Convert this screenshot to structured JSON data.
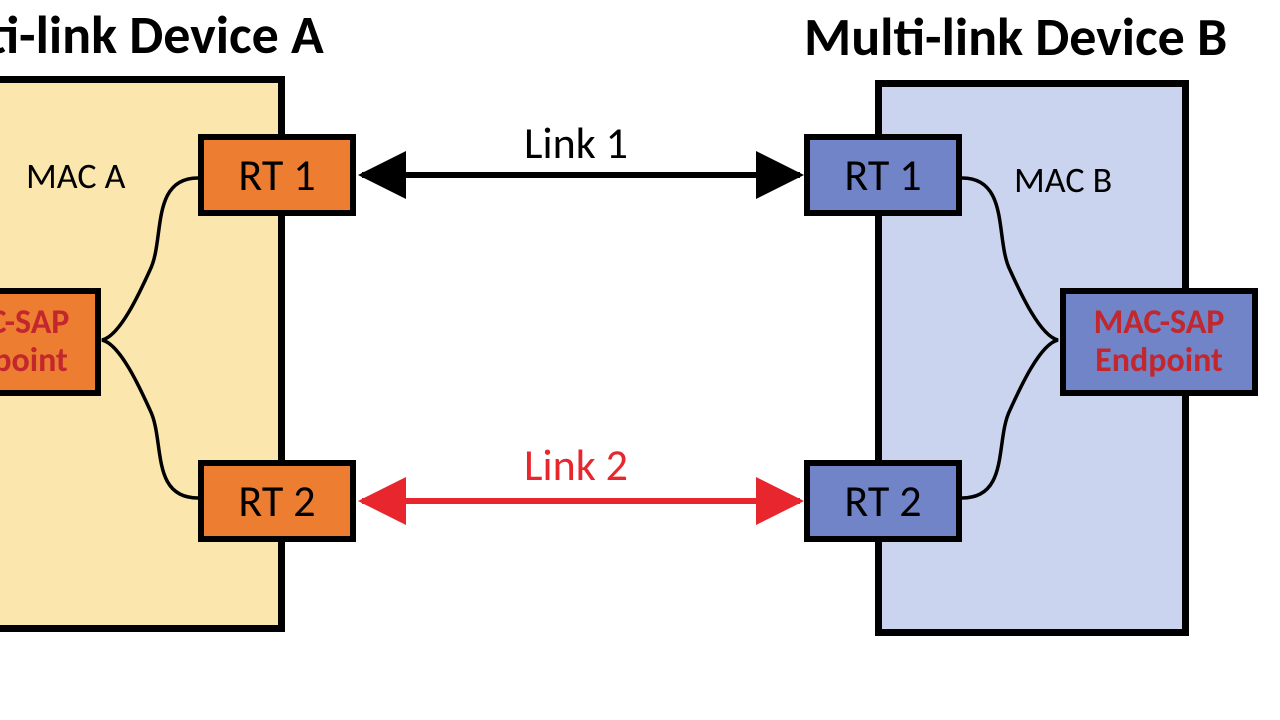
{
  "titles": {
    "deviceA": "Multi-link Device A",
    "deviceB": "Multi-link Device B"
  },
  "deviceA": {
    "fill": "#fbe6ad",
    "macLabel": "MAC A",
    "rt1": {
      "label": "RT 1",
      "fill": "#ed7d31"
    },
    "rt2": {
      "label": "RT 2",
      "fill": "#ed7d31"
    },
    "sap": {
      "line1": "MAC-SAP",
      "line2": "Endpoint",
      "fill": "#ed7d31"
    }
  },
  "deviceB": {
    "fill": "#cad4ee",
    "macLabel": "MAC B",
    "rt1": {
      "label": "RT 1",
      "fill": "#7184c7"
    },
    "rt2": {
      "label": "RT 2",
      "fill": "#7184c7"
    },
    "sap": {
      "line1": "MAC-SAP",
      "line2": "Endpoint",
      "fill": "#7184c7"
    }
  },
  "links": {
    "link1": {
      "label": "Link 1",
      "color": "#000000"
    },
    "link2": {
      "label": "Link 2",
      "color": "#e8262d"
    }
  }
}
